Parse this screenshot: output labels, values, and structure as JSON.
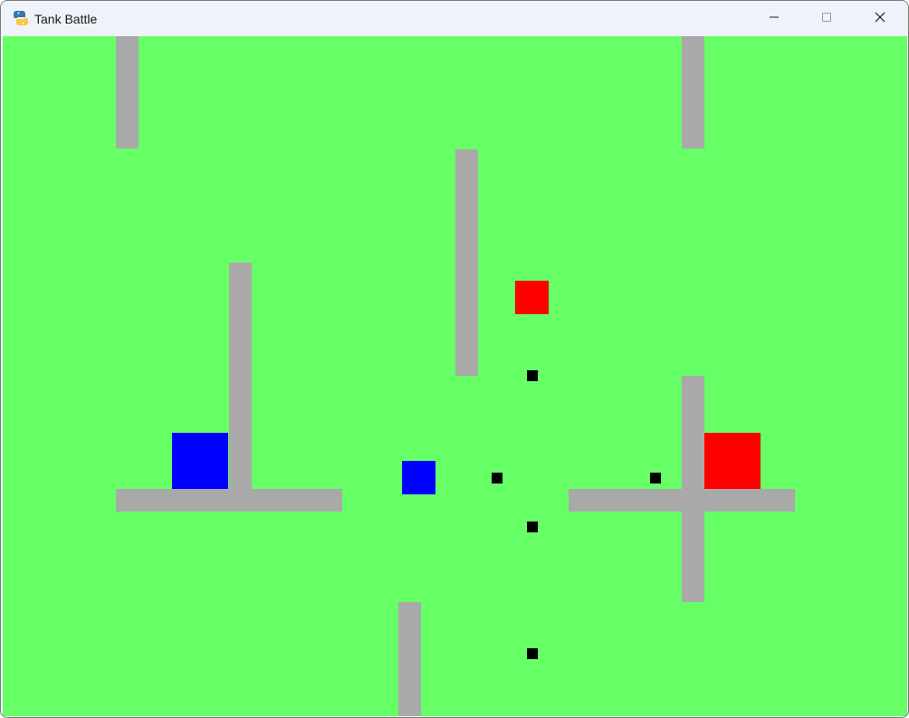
{
  "window": {
    "title": "Tank Battle",
    "app_icon": "python-icon",
    "controls": [
      "minimize-icon",
      "maximize-icon",
      "close-icon"
    ]
  },
  "game": {
    "colors": {
      "background": "#66ff66",
      "wall": "#a9a9a9",
      "blue_tank": "#0000ff",
      "red_tank": "#ff0000",
      "bullet": "#000000"
    }
  }
}
